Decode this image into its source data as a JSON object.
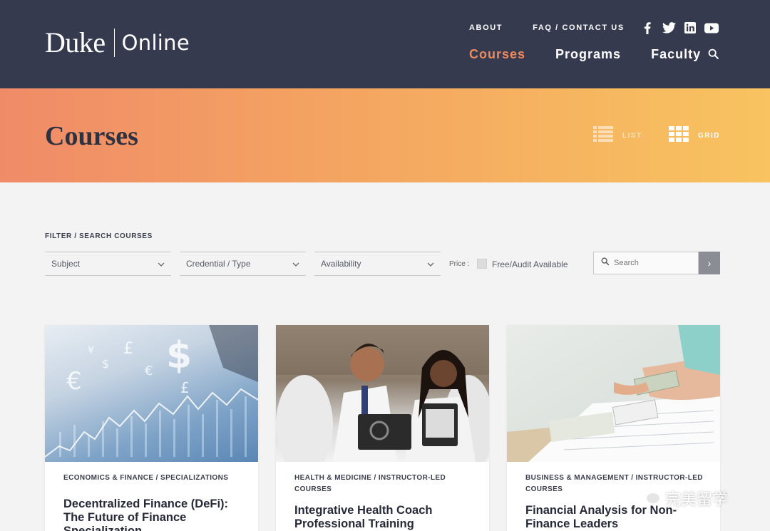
{
  "header": {
    "logo_primary": "Duke",
    "logo_secondary": "Online",
    "top_links": {
      "about": "ABOUT",
      "faq_contact": "FAQ / CONTACT US"
    },
    "nav": {
      "courses": "Courses",
      "programs": "Programs",
      "faculty": "Faculty"
    },
    "social_icons": [
      "facebook-icon",
      "twitter-icon",
      "linkedin-icon",
      "youtube-icon"
    ],
    "colors": {
      "background": "#363a4f",
      "active_nav": "#f08a5d"
    }
  },
  "banner": {
    "title": "Courses",
    "view_list_label": "LIST",
    "view_grid_label": "GRID",
    "active_view": "grid",
    "gradient": [
      "#f08b68",
      "#f8c360"
    ]
  },
  "filter": {
    "heading": "FILTER / SEARCH COURSES",
    "subject": "Subject",
    "credential": "Credential / Type",
    "availability": "Availability",
    "price_label": "Price :",
    "free_audit_label": "Free/Audit Available",
    "free_audit_checked": false,
    "search_placeholder": "Search"
  },
  "cards": [
    {
      "category": "ECONOMICS & FINANCE / SPECIALIZATIONS",
      "title": "Decentralized Finance (DeFi): The Future of Finance Specialization"
    },
    {
      "category": "HEALTH & MEDICINE / INSTRUCTOR-LED COURSES",
      "title": "Integrative Health Coach Professional Training"
    },
    {
      "category": "BUSINESS & MANAGEMENT / INSTRUCTOR-LED COURSES",
      "title": "Financial Analysis for Non-Finance Leaders"
    }
  ],
  "watermark": "完美留学"
}
